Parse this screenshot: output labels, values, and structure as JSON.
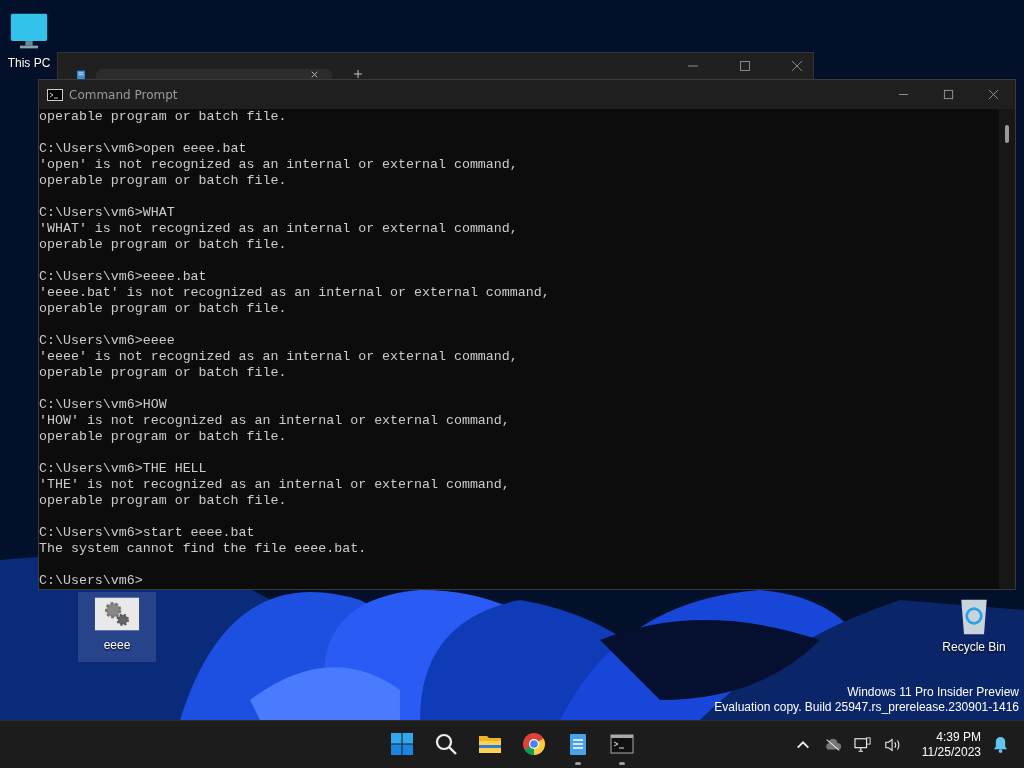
{
  "desktop_icons": [
    {
      "label": "This PC",
      "kind": "computer",
      "selected": false
    },
    {
      "label": "eeee",
      "kind": "settings-file",
      "selected": true
    },
    {
      "label": "Recycle Bin",
      "kind": "recycle-bin",
      "selected": false
    }
  ],
  "console_window": {
    "title": "Command Prompt",
    "blocks": [
      [
        "operable program or batch file."
      ],
      [
        "C:\\Users\\vm6>open eeee.bat",
        "'open' is not recognized as an internal or external command,",
        "operable program or batch file."
      ],
      [
        "C:\\Users\\vm6>WHAT",
        "'WHAT' is not recognized as an internal or external command,",
        "operable program or batch file."
      ],
      [
        "C:\\Users\\vm6>eeee.bat",
        "'eeee.bat' is not recognized as an internal or external command,",
        "operable program or batch file."
      ],
      [
        "C:\\Users\\vm6>eeee",
        "'eeee' is not recognized as an internal or external command,",
        "operable program or batch file."
      ],
      [
        "C:\\Users\\vm6>HOW",
        "'HOW' is not recognized as an internal or external command,",
        "operable program or batch file."
      ],
      [
        "C:\\Users\\vm6>THE HELL",
        "'THE' is not recognized as an internal or external command,",
        "operable program or batch file."
      ],
      [
        "C:\\Users\\vm6>start eeee.bat",
        "The system cannot find the file eeee.bat."
      ],
      [
        "C:\\Users\\vm6>"
      ]
    ]
  },
  "evaluation_notice": [
    "Windows 11 Pro Insider Preview",
    "Evaluation copy. Build 25947.rs_prerelease.230901-1416"
  ],
  "taskbar": {
    "apps": [
      {
        "kind": "start",
        "running": false
      },
      {
        "kind": "search",
        "running": false
      },
      {
        "kind": "folder",
        "running": false
      },
      {
        "kind": "browser",
        "running": false
      },
      {
        "kind": "notepad",
        "running": true
      },
      {
        "kind": "terminal",
        "running": true
      }
    ],
    "time": "4:39 PM",
    "date": "11/25/2023"
  }
}
